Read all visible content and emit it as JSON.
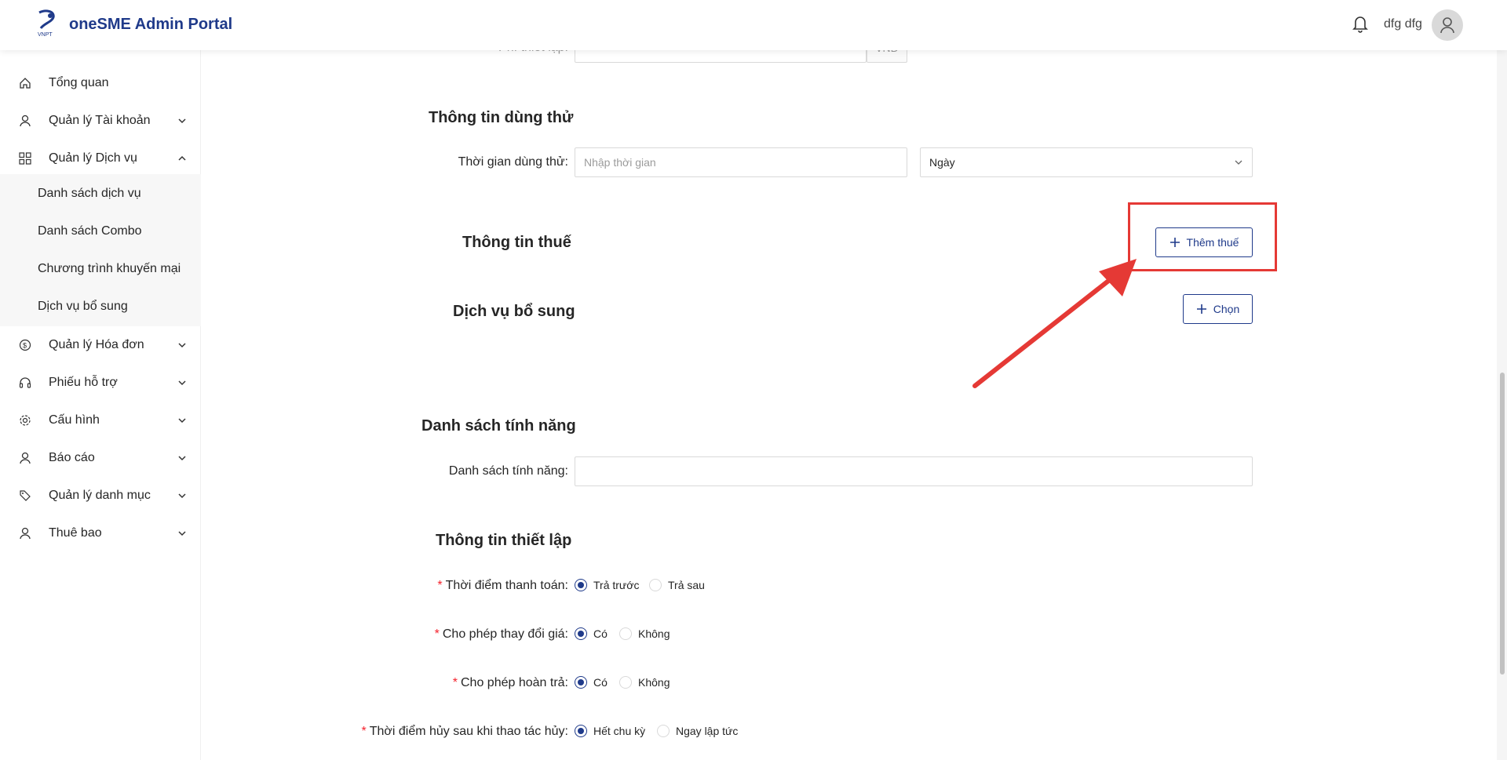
{
  "header": {
    "brand": "oneSME Admin Portal",
    "logo_text": "VNPT",
    "username": "dfg dfg"
  },
  "sidebar": {
    "items": [
      {
        "label": "Tổng quan",
        "icon": "home-icon"
      },
      {
        "label": "Quản lý Tài khoản",
        "icon": "user-icon"
      },
      {
        "label": "Quản lý Dịch vụ",
        "icon": "grid-icon"
      },
      {
        "label": "Quản lý Hóa đơn",
        "icon": "dollar-icon"
      },
      {
        "label": "Phiếu hỗ trợ",
        "icon": "headset-icon"
      },
      {
        "label": "Cấu hình",
        "icon": "gear-icon"
      },
      {
        "label": "Báo cáo",
        "icon": "user-icon"
      },
      {
        "label": "Quản lý danh mục",
        "icon": "tag-icon"
      },
      {
        "label": "Thuê bao",
        "icon": "user-icon"
      }
    ],
    "subitems": [
      "Danh sách dịch vụ",
      "Danh sách Combo",
      "Chương trình khuyến mại",
      "Dịch vụ bổ sung"
    ]
  },
  "form": {
    "partial_label": "Phí thiết lập:",
    "partial_suffix": "VNĐ",
    "trial_section": "Thông tin dùng thử",
    "trial_label": "Thời gian dùng thử:",
    "trial_placeholder": "Nhập thời gian",
    "trial_unit": "Ngày",
    "tax_section": "Thông tin thuế",
    "add_tax_button": "Thêm thuế",
    "addon_section": "Dịch vụ bổ sung",
    "choose_button": "Chọn",
    "features_section": "Danh sách tính năng",
    "features_label": "Danh sách tính năng:",
    "setup_section": "Thông tin thiết lập",
    "payment_time_label": "Thời điểm thanh toán:",
    "payment_options": [
      "Trả trước",
      "Trả sau"
    ],
    "change_price_label": "Cho phép thay đổi giá:",
    "change_price_options": [
      "Có",
      "Không"
    ],
    "refund_label": "Cho phép hoàn trả:",
    "refund_options": [
      "Có",
      "Không"
    ],
    "cancel_time_label": "Thời điểm hủy sau khi thao tác hủy:",
    "cancel_options": [
      "Hết chu kỳ",
      "Ngay lập tức"
    ]
  },
  "colors": {
    "brand": "#1f3a8a",
    "highlight": "#e53935",
    "required": "#f5222d"
  }
}
